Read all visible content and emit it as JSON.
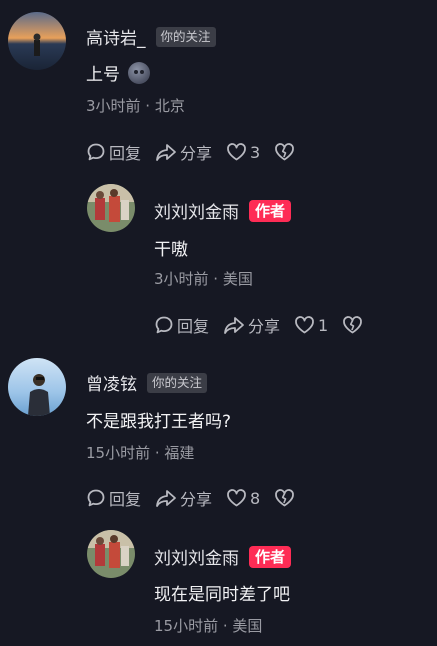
{
  "comments": [
    {
      "name": "高诗岩_",
      "badge": "你的关注",
      "text": "上号",
      "emoji": "moon-face-emoji",
      "meta": "3小时前 · 北京",
      "reply_label": "回复",
      "share_label": "分享",
      "like_count": "3"
    },
    {
      "name": "刘刘刘金雨",
      "badge": "作者",
      "text": "干嗷",
      "meta": "3小时前 · 美国",
      "reply_label": "回复",
      "share_label": "分享",
      "like_count": "1"
    },
    {
      "name": "曾凌铉",
      "badge": "你的关注",
      "text": "不是跟我打王者吗?",
      "meta": "15小时前 · 福建",
      "reply_label": "回复",
      "share_label": "分享",
      "like_count": "8"
    },
    {
      "name": "刘刘刘金雨",
      "badge": "作者",
      "text": "现在是同时差了吧",
      "meta": "15小时前 · 美国"
    }
  ],
  "colors": {
    "background": "#161823",
    "author_badge": "#fe2c55",
    "secondary_text": "#9a9ba3"
  }
}
